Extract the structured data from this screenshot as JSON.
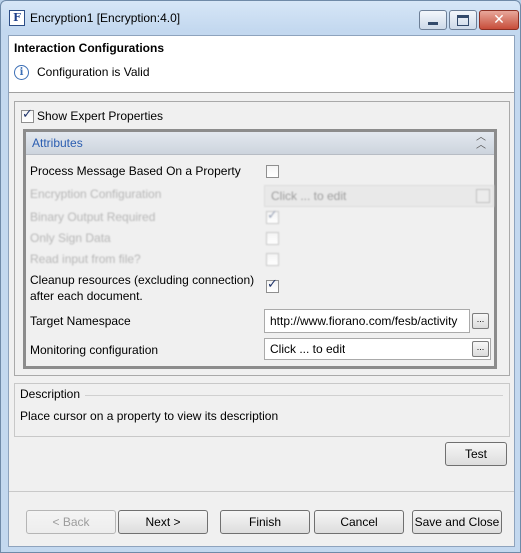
{
  "window": {
    "title": "Encryption1 [Encryption:4.0]",
    "app_icon_letter": "F",
    "close_glyph": "✕"
  },
  "header": {
    "title": "Interaction Configurations",
    "info_glyph": "i",
    "status": "Configuration is Valid"
  },
  "options": {
    "show_expert_label": "Show Expert Properties",
    "show_expert_checked": true
  },
  "attributes": {
    "title": "Attributes",
    "collapse_glyph": "︿︿",
    "properties": [
      {
        "label": "Process Message Based On a Property",
        "checked": false
      },
      {
        "label": "Encryption Configuration",
        "value": "Click ... to edit"
      },
      {
        "label": "Binary Output Required",
        "checked": true
      },
      {
        "label": "Only Sign Data",
        "checked": false
      },
      {
        "label": "Read input from file?",
        "checked": false
      },
      {
        "label_line1": "Cleanup resources (excluding connection)",
        "label_line2": "after each document.",
        "checked": true
      },
      {
        "label": "Target Namespace",
        "value": "http://www.fiorano.com/fesb/activity"
      },
      {
        "label": "Monitoring configuration",
        "value": "Click ... to edit"
      }
    ],
    "ellipsis_glyph": "..."
  },
  "description": {
    "title": "Description",
    "text": "Place cursor on a property to view its description"
  },
  "buttons": {
    "test": "Test",
    "back": "< Back",
    "next": "Next >",
    "finish": "Finish",
    "cancel": "Cancel",
    "save_close": "Save and Close"
  },
  "tick_glyph": "✓"
}
